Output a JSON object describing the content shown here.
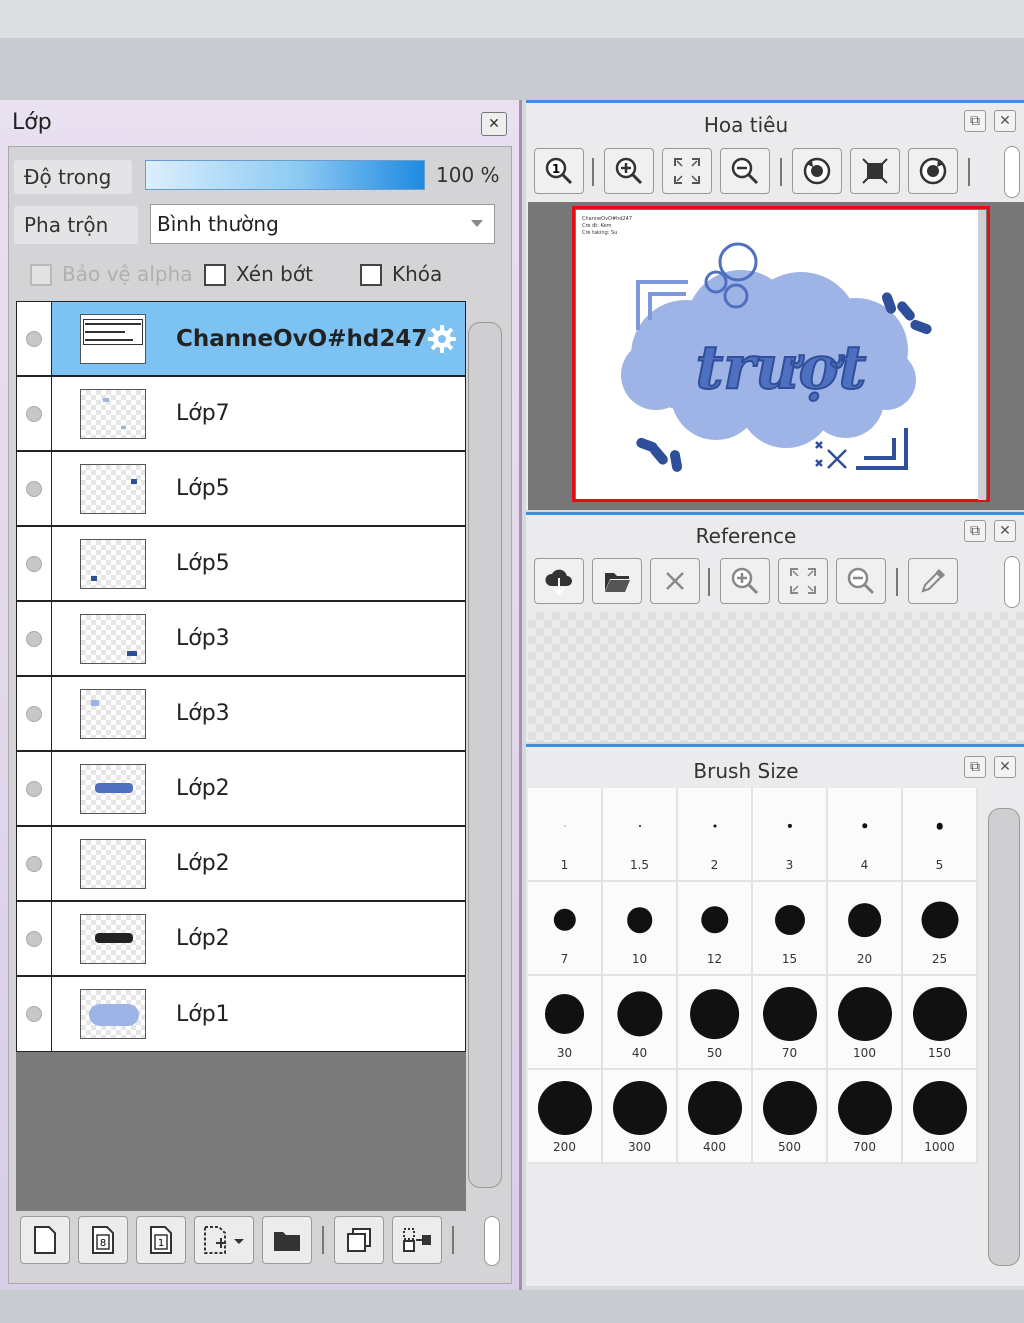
{
  "layer_panel": {
    "title": "Lớp",
    "opacity_label": "Độ trong",
    "opacity_value": "100 %",
    "opacity_fraction": 1.0,
    "blend_label": "Pha trộn",
    "blend_mode": "Bình thường",
    "options": [
      {
        "label": "Bảo vệ alpha",
        "checked": false,
        "disabled": true
      },
      {
        "label": "Xén bớt",
        "checked": false,
        "disabled": false
      },
      {
        "label": "Khóa",
        "checked": false,
        "disabled": false
      }
    ],
    "layers": [
      {
        "name": "ChanneOvO#hd247",
        "selected": true
      },
      {
        "name": "Lớp7",
        "selected": false
      },
      {
        "name": "Lớp5",
        "selected": false
      },
      {
        "name": "Lớp5",
        "selected": false
      },
      {
        "name": "Lớp3",
        "selected": false
      },
      {
        "name": "Lớp3",
        "selected": false
      },
      {
        "name": "Lớp2",
        "selected": false
      },
      {
        "name": "Lớp2",
        "selected": false
      },
      {
        "name": "Lớp2",
        "selected": false
      },
      {
        "name": "Lớp1",
        "selected": false
      }
    ]
  },
  "navigator": {
    "title": "Hoa tiêu",
    "canvas_text": "trượt",
    "canvas_small_text": [
      "ChanneOvO#hd247",
      "Cre đt: Kem",
      "Cre taking: Su"
    ]
  },
  "reference": {
    "title": "Reference"
  },
  "brush_size": {
    "title": "Brush Size",
    "sizes": [
      {
        "label": "1",
        "value": 1
      },
      {
        "label": "1.5",
        "value": 1.5
      },
      {
        "label": "2",
        "value": 2
      },
      {
        "label": "3",
        "value": 3
      },
      {
        "label": "4",
        "value": 4
      },
      {
        "label": "5",
        "value": 5
      },
      {
        "label": "7",
        "value": 7
      },
      {
        "label": "10",
        "value": 10
      },
      {
        "label": "12",
        "value": 12
      },
      {
        "label": "15",
        "value": 15
      },
      {
        "label": "20",
        "value": 20
      },
      {
        "label": "25",
        "value": 25
      },
      {
        "label": "30",
        "value": 30
      },
      {
        "label": "40",
        "value": 40
      },
      {
        "label": "50",
        "value": 50
      },
      {
        "label": "70",
        "value": 70
      },
      {
        "label": "100",
        "value": 100
      },
      {
        "label": "150",
        "value": 150
      },
      {
        "label": "200",
        "value": 200
      },
      {
        "label": "300",
        "value": 300
      },
      {
        "label": "400",
        "value": 400
      },
      {
        "label": "500",
        "value": 500
      },
      {
        "label": "700",
        "value": 700
      },
      {
        "label": "1000",
        "value": 1000
      }
    ]
  },
  "colors": {
    "selection_blue": "#7cc3f3",
    "panel_accent": "#3e8fe0",
    "nav_frame": "#e01010",
    "art_blue": "#9fb4e6",
    "art_dark": "#2f4f9a"
  }
}
